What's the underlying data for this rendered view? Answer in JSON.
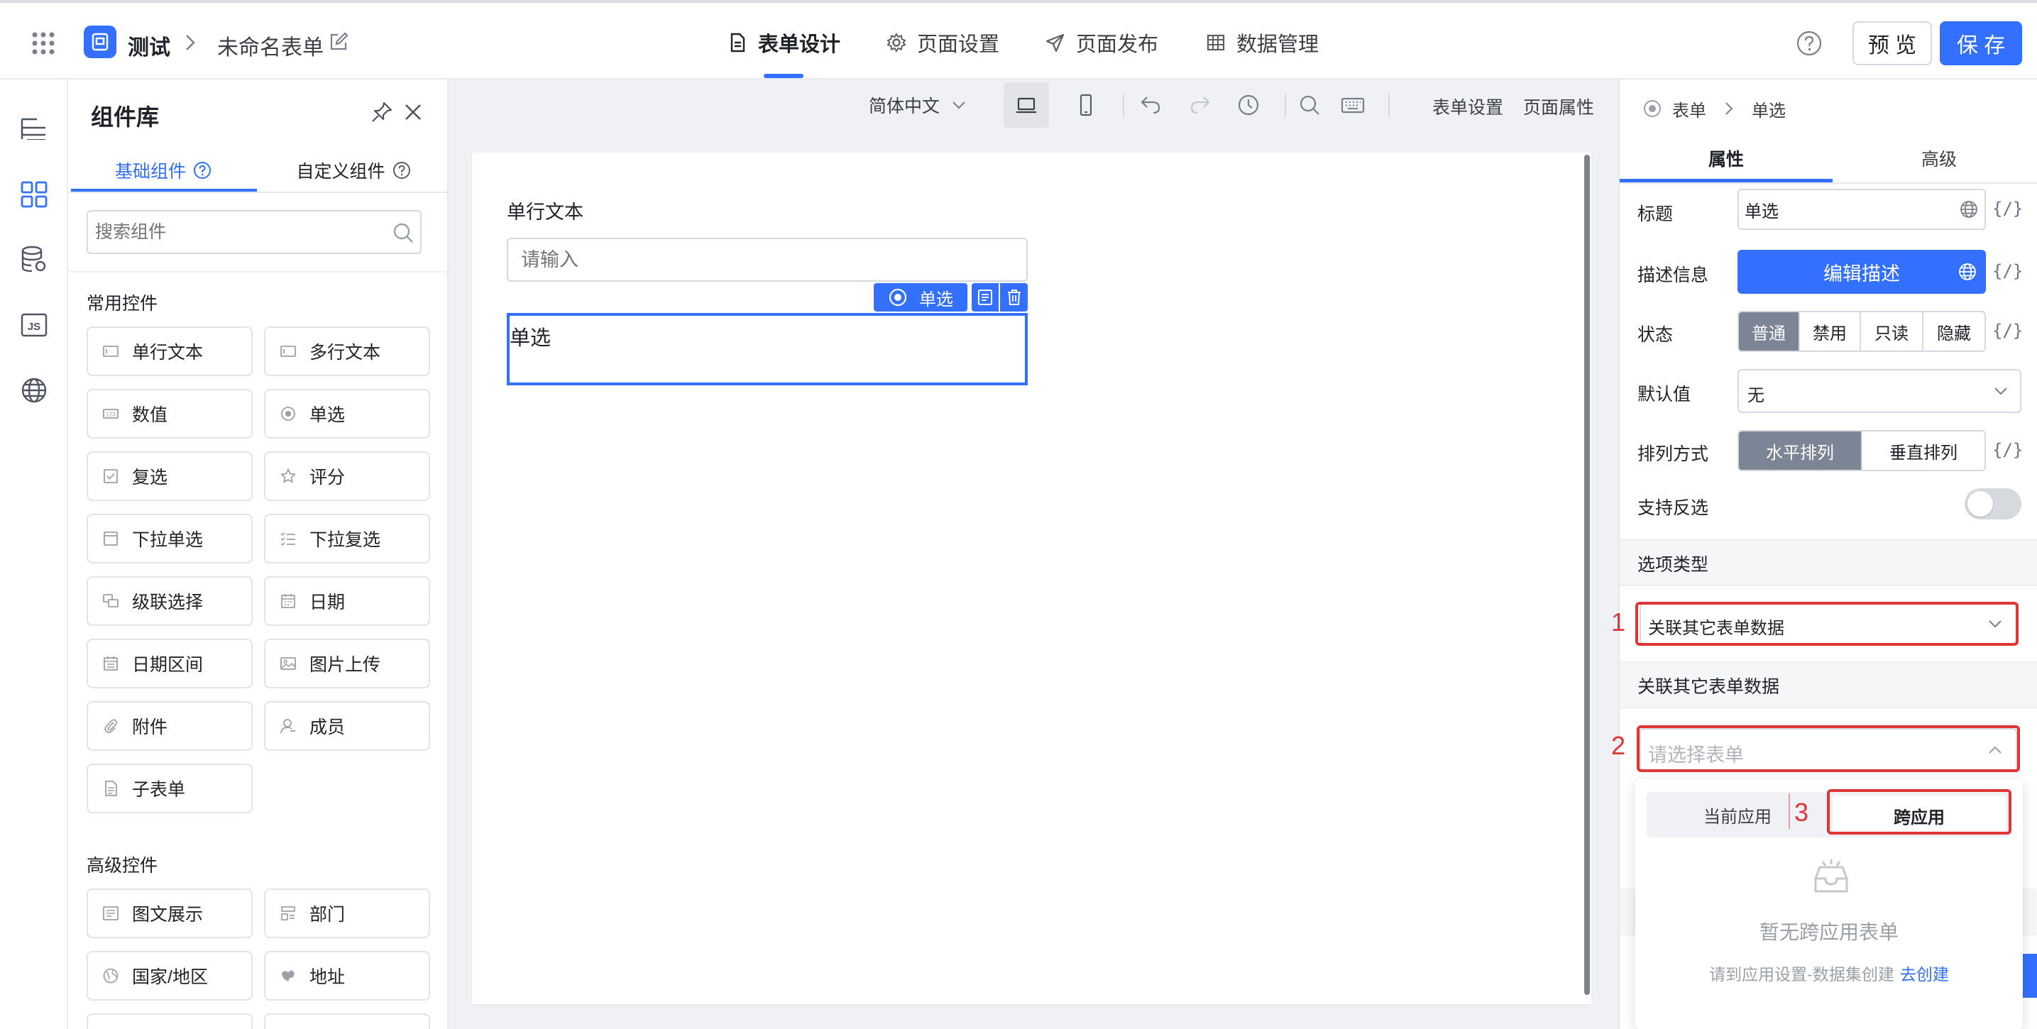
{
  "header": {
    "app_name": "测试",
    "form_name": "未命名表单",
    "tabs": [
      {
        "label": "表单设计",
        "icon": "document-icon",
        "active": true
      },
      {
        "label": "页面设置",
        "icon": "gear-icon",
        "active": false
      },
      {
        "label": "页面发布",
        "icon": "send-icon",
        "active": false
      },
      {
        "label": "数据管理",
        "icon": "table-icon",
        "active": false
      }
    ],
    "help_icon": "help-icon",
    "preview_label": "预 览",
    "save_label": "保 存"
  },
  "iconbar": [
    "outline-icon",
    "components-icon",
    "datasource-icon",
    "js-icon",
    "globe-icon"
  ],
  "component_panel": {
    "title": "组件库",
    "tabs": [
      {
        "label": "基础组件",
        "active": true
      },
      {
        "label": "自定义组件",
        "active": false
      }
    ],
    "search_placeholder": "搜索组件",
    "common_title": "常用控件",
    "common": [
      {
        "label": "单行文本",
        "icon": "input-icon"
      },
      {
        "label": "多行文本",
        "icon": "textarea-icon"
      },
      {
        "label": "数值",
        "icon": "number-icon"
      },
      {
        "label": "单选",
        "icon": "radio-icon"
      },
      {
        "label": "复选",
        "icon": "checkbox-icon"
      },
      {
        "label": "评分",
        "icon": "star-icon"
      },
      {
        "label": "下拉单选",
        "icon": "select-icon"
      },
      {
        "label": "下拉复选",
        "icon": "multiselect-icon"
      },
      {
        "label": "级联选择",
        "icon": "cascade-icon"
      },
      {
        "label": "日期",
        "icon": "calendar-icon"
      },
      {
        "label": "日期区间",
        "icon": "date-range-icon"
      },
      {
        "label": "图片上传",
        "icon": "image-icon"
      },
      {
        "label": "附件",
        "icon": "paperclip-icon"
      },
      {
        "label": "成员",
        "icon": "user-icon"
      },
      {
        "label": "子表单",
        "icon": "subform-icon"
      }
    ],
    "advanced_title": "高级控件",
    "advanced": [
      {
        "label": "图文展示",
        "icon": "richtext-icon"
      },
      {
        "label": "部门",
        "icon": "department-icon"
      },
      {
        "label": "国家/地区",
        "icon": "globe-icon"
      },
      {
        "label": "地址",
        "icon": "map-icon"
      }
    ]
  },
  "toolbar": {
    "language": "简体中文",
    "form_settings": "表单设置",
    "page_props": "页面属性"
  },
  "canvas": {
    "field1_label": "单行文本",
    "field1_placeholder": "请输入",
    "selected_tag": "单选",
    "field2_label": "单选"
  },
  "right_panel": {
    "breadcrumb": [
      "表单",
      "单选"
    ],
    "tabs": [
      {
        "label": "属性",
        "active": true
      },
      {
        "label": "高级",
        "active": false
      }
    ],
    "title_label": "标题",
    "title_value": "单选",
    "desc_label": "描述信息",
    "desc_button": "编辑描述",
    "state_label": "状态",
    "state_options": [
      "普通",
      "禁用",
      "只读",
      "隐藏"
    ],
    "state_selected": "普通",
    "default_label": "默认值",
    "default_value": "无",
    "layout_label": "排列方式",
    "layout_options": [
      "水平排列",
      "垂直排列"
    ],
    "layout_selected": "水平排列",
    "invert_label": "支持反选",
    "invert_on": false,
    "option_type_title": "选项类型",
    "option_type_value": "关联其它表单数据",
    "linked_title": "关联其它表单数据",
    "select_form_placeholder": "请选择表单",
    "dropdown_tabs": [
      "当前应用",
      "跨应用"
    ],
    "dropdown_active": "跨应用",
    "empty_title": "暂无跨应用表单",
    "empty_hint": "请到应用设置-数据集创建",
    "empty_link": "去创建",
    "braces": "{/}"
  },
  "annotations": [
    "1",
    "2",
    "3"
  ],
  "colors": {
    "primary": "#3370ff",
    "annotation_red": "#e03535",
    "segment_selected": "#7b8595"
  }
}
